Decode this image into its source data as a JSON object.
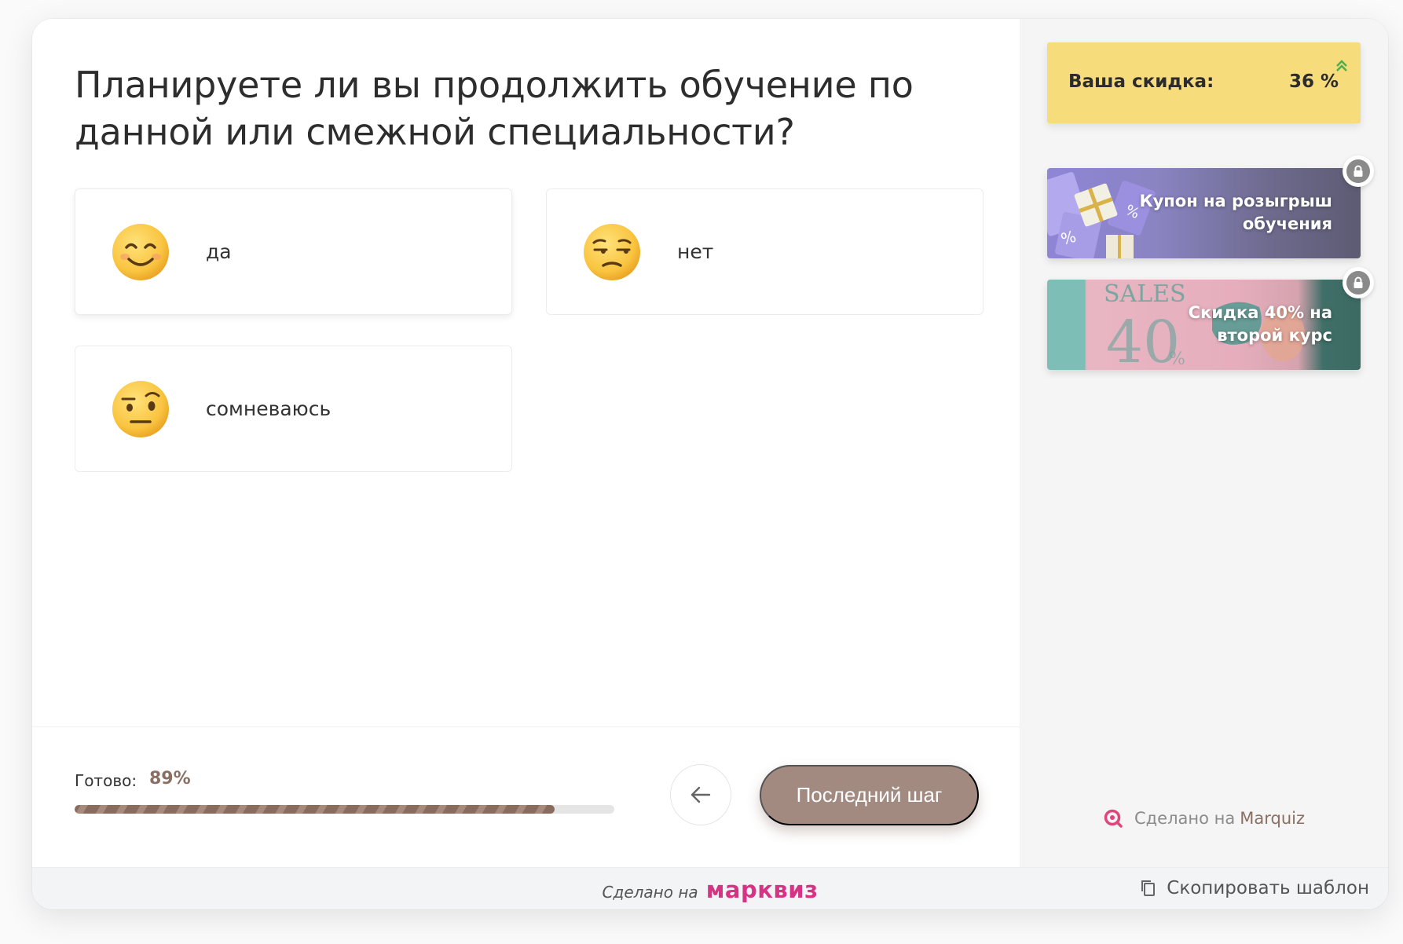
{
  "question": {
    "line1": "Планируете ли вы продолжить обучение по",
    "line2": "данной или смежной специальности?"
  },
  "options": [
    {
      "label": "да",
      "emoji": "smiling-face-icon"
    },
    {
      "label": "нет",
      "emoji": "unamused-face-icon"
    },
    {
      "label": "сомневаюсь",
      "emoji": "raised-eyebrow-face-icon"
    }
  ],
  "progress": {
    "label": "Готово:",
    "value_text": "89%",
    "value": 0.89
  },
  "nav": {
    "back_icon": "arrow-left-icon",
    "next_label": "Последний шаг"
  },
  "sidebar": {
    "discount_label": "Ваша скидка:",
    "discount_value": "36 %",
    "bonuses": [
      {
        "title": "Купон на розыгрыш обучения",
        "locked": true
      },
      {
        "title": "Скидка 40% на второй курс",
        "locked": true
      }
    ],
    "made_on_prefix": "Сделано на",
    "made_on_brand": "Marquiz"
  },
  "footer": {
    "made_on_prefix": "Сделано на",
    "brand": "марквиз",
    "copy_template": "Скопировать шаблон"
  },
  "colors": {
    "accent": "#a38a80",
    "progress": "#8a6c5f",
    "discount_bg": "#f7dc7b",
    "brand_pink": "#d63384"
  }
}
